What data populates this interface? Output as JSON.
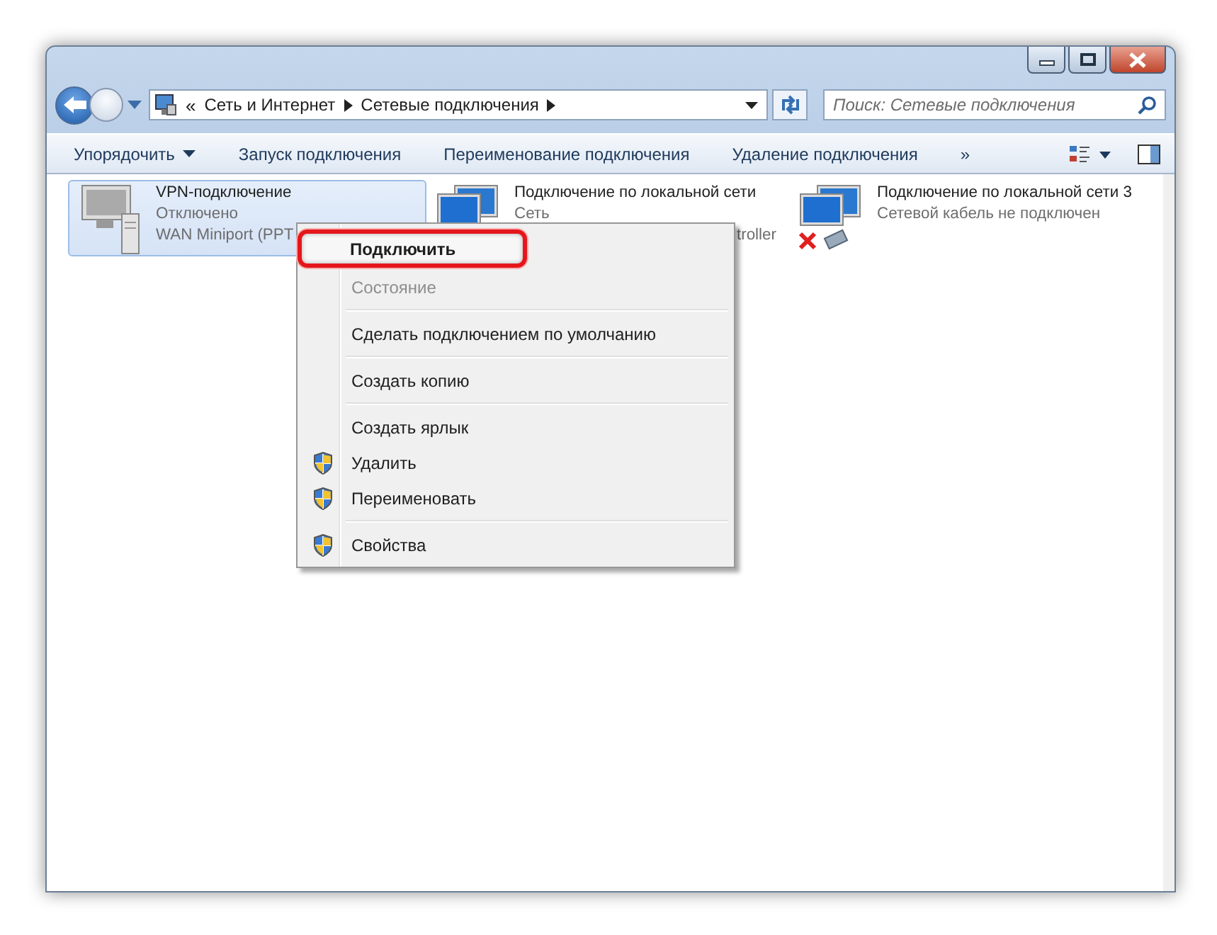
{
  "address_bar": {
    "overflow": "«",
    "path": [
      "Сеть и Интернет",
      "Сетевые подключения"
    ]
  },
  "search": {
    "placeholder": "Поиск: Сетевые подключения"
  },
  "toolbar": {
    "items": [
      {
        "label": "Упорядочить",
        "dropdown": true
      },
      {
        "label": "Запуск подключения",
        "dropdown": false
      },
      {
        "label": "Переименование подключения",
        "dropdown": false
      },
      {
        "label": "Удаление подключения",
        "dropdown": false
      }
    ],
    "overflow": "»"
  },
  "connections": [
    {
      "kind": "vpn",
      "name": "VPN-подключение",
      "lines": [
        "Отключено",
        "WAN Miniport (PPT"
      ],
      "selected": true
    },
    {
      "kind": "lan",
      "name": "Подключение по локальной сети",
      "lines": [
        "Сеть",
        "troller"
      ],
      "selected": false
    },
    {
      "kind": "lan-disconnected",
      "name": "Подключение по локальной сети 3",
      "lines": [
        "Сетевой кабель не подключен"
      ],
      "selected": false
    }
  ],
  "context_menu": [
    {
      "kind": "item",
      "label": "Подключить",
      "default": true,
      "disabled": false,
      "shield": false,
      "highlighted": true
    },
    {
      "kind": "item",
      "label": "Состояние",
      "default": false,
      "disabled": true,
      "shield": false,
      "highlighted": false
    },
    {
      "kind": "separator"
    },
    {
      "kind": "item",
      "label": "Сделать подключением по умолчанию",
      "default": false,
      "disabled": false,
      "shield": false,
      "highlighted": false
    },
    {
      "kind": "separator"
    },
    {
      "kind": "item",
      "label": "Создать копию",
      "default": false,
      "disabled": false,
      "shield": false,
      "highlighted": false
    },
    {
      "kind": "separator"
    },
    {
      "kind": "item",
      "label": "Создать ярлык",
      "default": false,
      "disabled": false,
      "shield": false,
      "highlighted": false
    },
    {
      "kind": "item",
      "label": "Удалить",
      "default": false,
      "disabled": false,
      "shield": true,
      "highlighted": false
    },
    {
      "kind": "item",
      "label": "Переименовать",
      "default": false,
      "disabled": false,
      "shield": true,
      "highlighted": false
    },
    {
      "kind": "separator"
    },
    {
      "kind": "item",
      "label": "Свойства",
      "default": false,
      "disabled": false,
      "shield": true,
      "highlighted": false
    }
  ]
}
